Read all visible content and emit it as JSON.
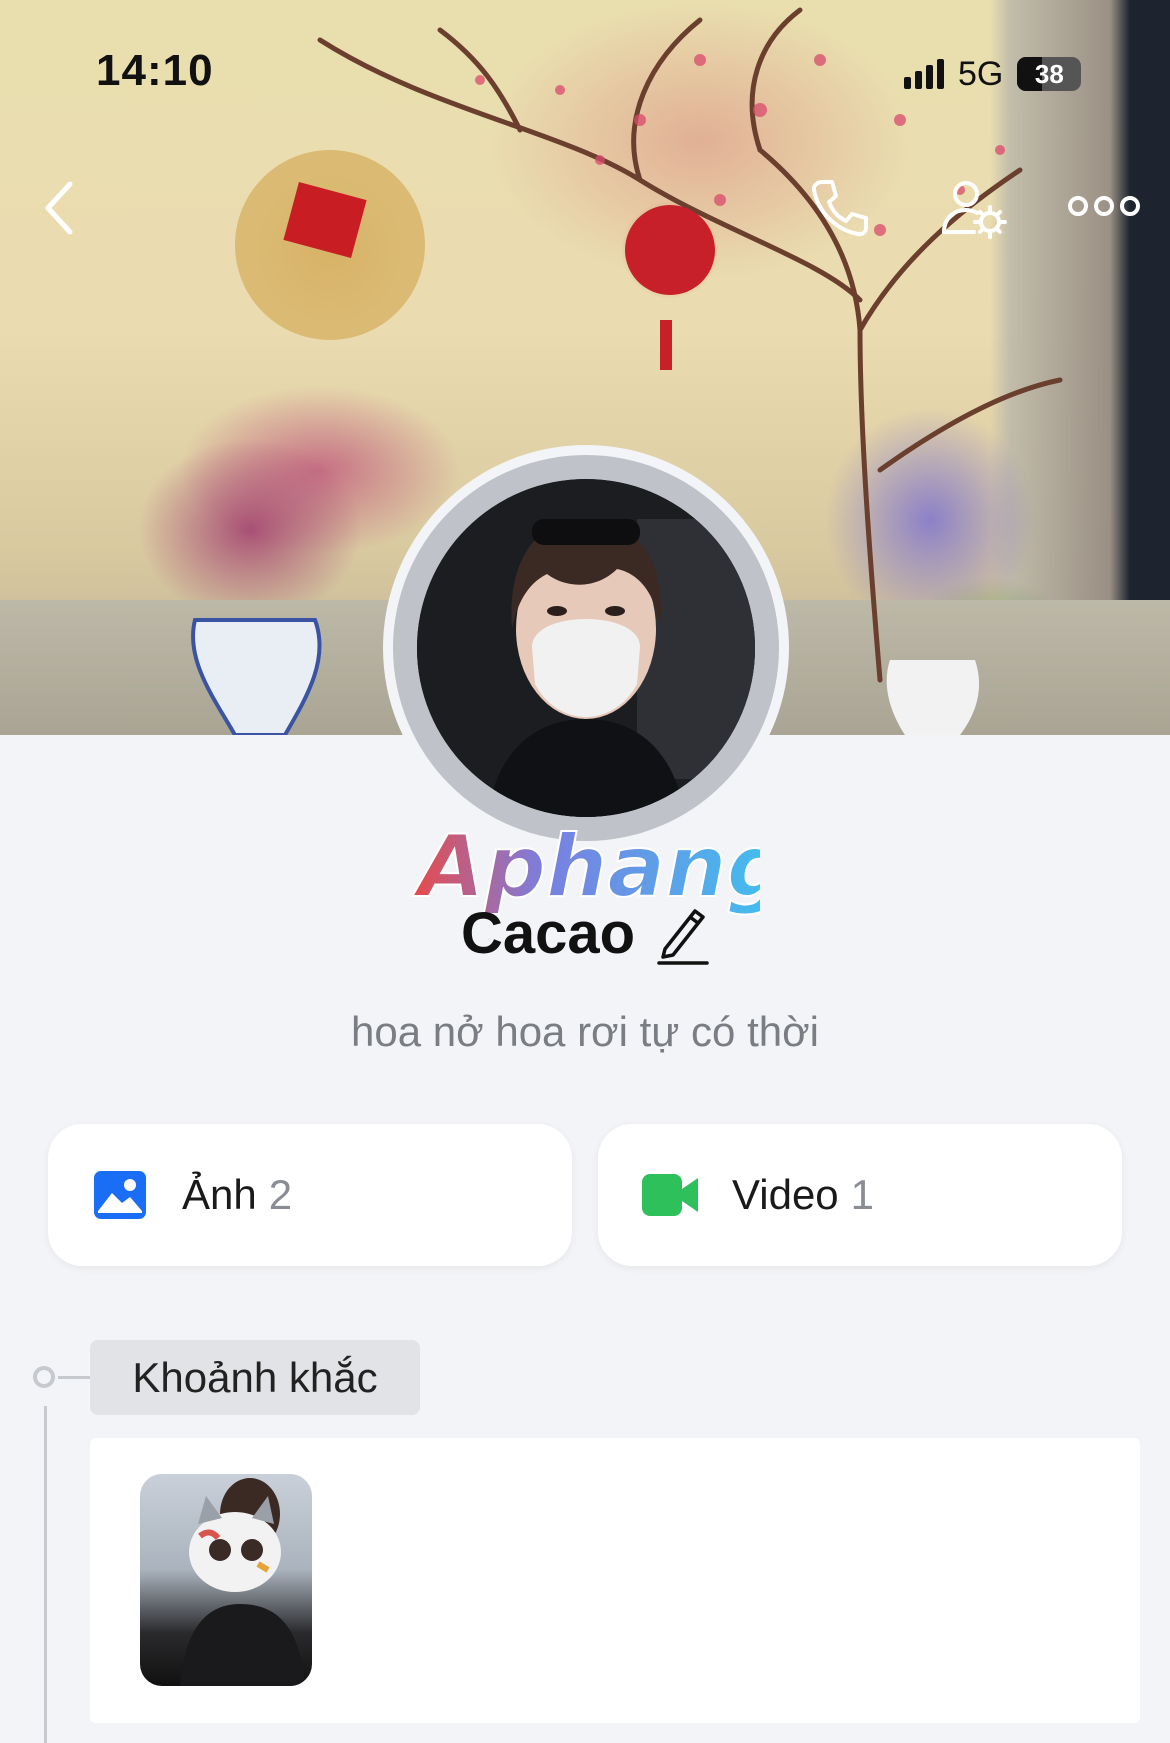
{
  "status_bar": {
    "time": "14:10",
    "network": "5G",
    "battery": "38",
    "battery_level": 0.38
  },
  "nav": {
    "back_icon": "chevron-left-icon",
    "call_icon": "phone-icon",
    "friend_settings_icon": "user-gear-icon",
    "more_icon": "more-dots-icon"
  },
  "profile": {
    "name": "Cacao",
    "bio": "hoa nở hoa rơi tự có thời",
    "watermark": "Aphang"
  },
  "media": {
    "photos": {
      "label": "Ảnh",
      "count": "2",
      "icon": "image-icon",
      "color": "#1a6ef5"
    },
    "videos": {
      "label": "Video",
      "count": "1",
      "icon": "video-camera-icon",
      "color": "#2ec05a"
    }
  },
  "moments": {
    "title": "Khoảnh khắc"
  }
}
